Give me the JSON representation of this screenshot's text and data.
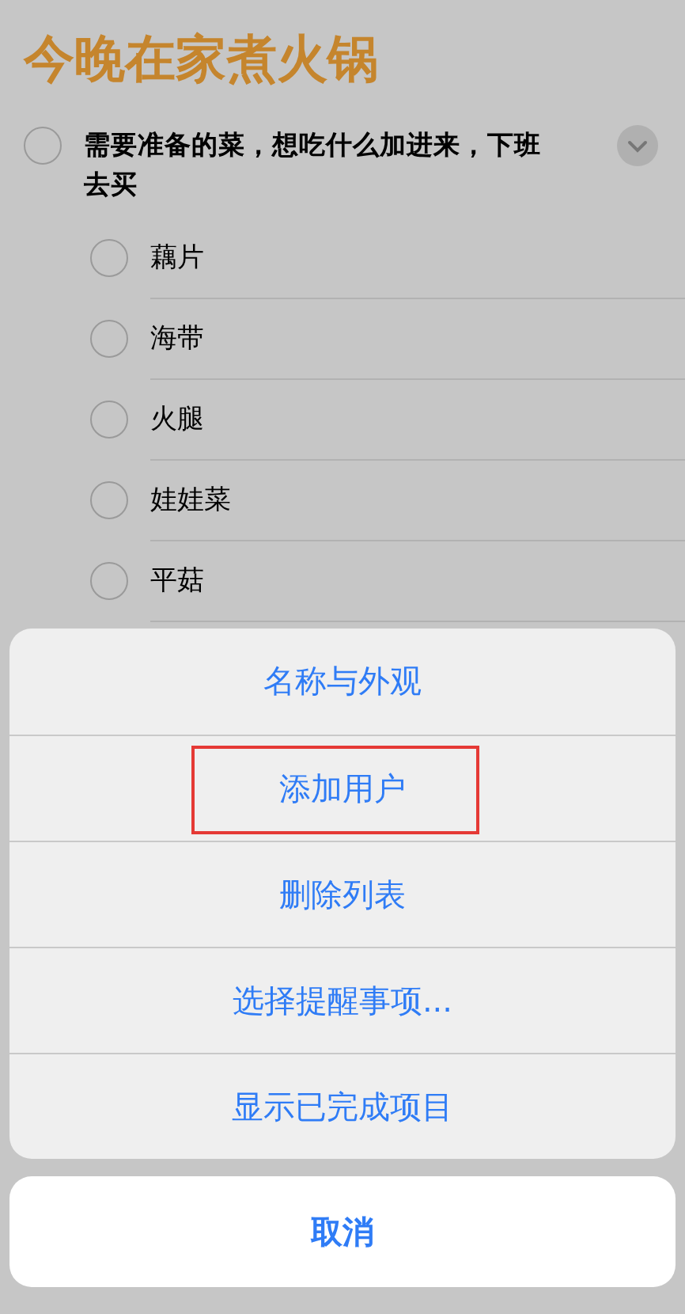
{
  "list": {
    "title": "今晚在家煮火锅",
    "main_item": {
      "text": "需要准备的菜，想吃什么加进来，下班去买",
      "completed": false,
      "expanded": true
    },
    "subitems": [
      {
        "text": "藕片",
        "completed": false
      },
      {
        "text": "海带",
        "completed": false
      },
      {
        "text": "火腿",
        "completed": false
      },
      {
        "text": "娃娃菜",
        "completed": false
      },
      {
        "text": "平菇",
        "completed": false
      }
    ]
  },
  "action_sheet": {
    "actions": [
      {
        "label": "名称与外观",
        "highlighted": false
      },
      {
        "label": "添加用户",
        "highlighted": true
      },
      {
        "label": "删除列表",
        "highlighted": false
      },
      {
        "label": "选择提醒事项...",
        "highlighted": false
      },
      {
        "label": "显示已完成项目",
        "highlighted": false
      }
    ],
    "cancel": "取消"
  }
}
